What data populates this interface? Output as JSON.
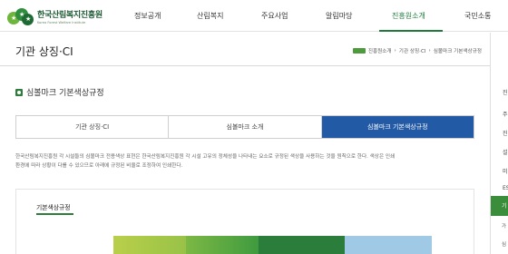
{
  "header": {
    "logo_ko": "한국산림복지진흥원",
    "logo_en": "Korea Forest Welfare Institute",
    "nav": [
      "정보공개",
      "산림복지",
      "주요사업",
      "알림마당",
      "진흥원소개",
      "국민소통"
    ],
    "active_nav_index": 4
  },
  "titlebar": {
    "title": "기관 상징·CI",
    "breadcrumb": [
      "진흥원소개",
      "기관 상징·CI",
      "심볼마크 기본색상규정"
    ]
  },
  "section": {
    "title": "심볼마크 기본색상규정"
  },
  "tabs": [
    {
      "label": "기관 상징·CI",
      "active": false
    },
    {
      "label": "심볼마크 소개",
      "active": false
    },
    {
      "label": "심볼마크 기본색상규정",
      "active": true
    }
  ],
  "description": {
    "line1": "한국산림복지진흥원 각 시설들의 심볼마크 전용색상 표현은 한국산림복지진흥원 각 시설 고유의 정체성을 나타내는 요소로 규정된 색상을 사용하는 것을 원칙으로 한다. 색상은 인쇄",
    "line2": "환경에 따라 상황이 다를 수 있으므로 아래에 규정된 비율로 조정하여 인쇄한다."
  },
  "spec": {
    "label": "기본색상규정",
    "swatches": [
      "#b9cf4a",
      "#3f9b3f",
      "#2a7d3a",
      "#9fc9e4"
    ]
  },
  "sidebar": {
    "items": [
      "진",
      "주",
      "진",
      "설",
      "미",
      "ES",
      "기",
      "가",
      "심"
    ]
  },
  "colors": {
    "brand_green": "#1f7a3c",
    "tab_active": "#225aa5"
  }
}
